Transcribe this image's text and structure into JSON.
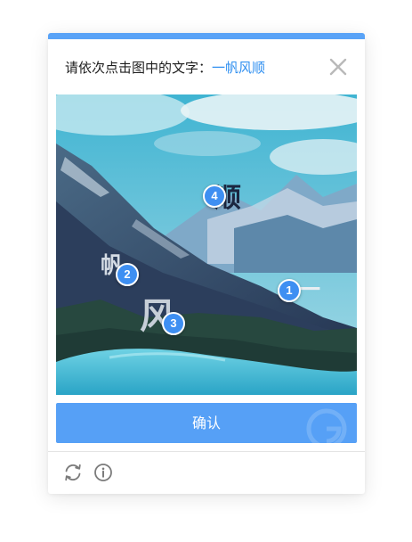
{
  "prompt": {
    "text": "请依次点击图中的文字：",
    "target_word": "一帆风顺"
  },
  "captcha": {
    "characters": [
      {
        "char": "顺",
        "marker": "4"
      },
      {
        "char": "帆",
        "marker": "2"
      },
      {
        "char": "风",
        "marker": "3"
      },
      {
        "char": "一",
        "marker": "1"
      }
    ]
  },
  "confirm_label": "确认",
  "colors": {
    "accent": "#59a3f7",
    "button": "#56a0f6",
    "marker": "#3e8ff2",
    "target_text": "#2f8ff0"
  },
  "icons": {
    "close": "close-icon",
    "refresh": "refresh-icon",
    "info": "info-icon"
  }
}
